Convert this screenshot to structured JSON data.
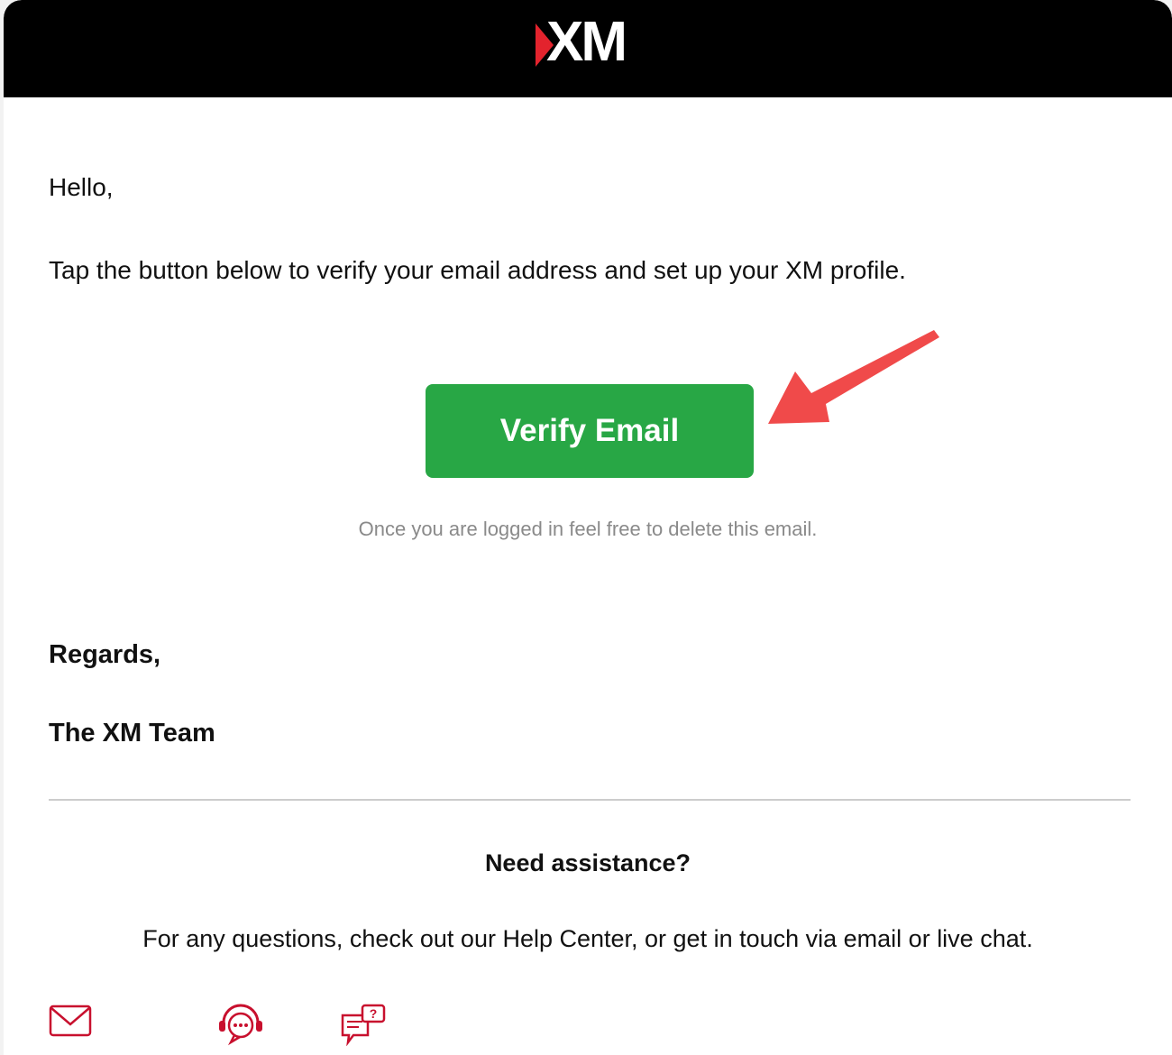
{
  "header": {
    "logo_text": "XM",
    "brand_color": "#e3232d",
    "background": "#000000"
  },
  "body": {
    "greeting": "Hello,",
    "intro": "Tap the button below to verify your email address and set up your XM profile.",
    "verify_button_label": "Verify Email",
    "verify_button_color": "#28a745",
    "note": "Once you are logged in feel free to delete this email.",
    "regards": "Regards,",
    "signature": "The XM Team"
  },
  "assistance": {
    "title": "Need assistance?",
    "text": "For any questions, check out our Help Center, or get in touch via email or live chat.",
    "icons": [
      "mail-icon",
      "live-chat-support-icon",
      "help-center-faq-icon"
    ],
    "icon_color": "#c8102e"
  },
  "annotation": {
    "arrow_color": "#f04a4a"
  }
}
